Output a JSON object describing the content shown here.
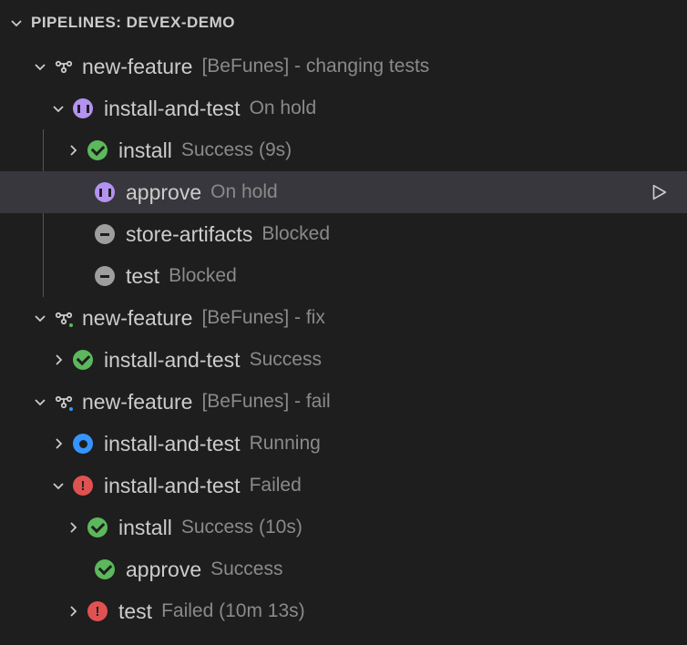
{
  "header": {
    "title": "PIPELINES: DEVEX-DEMO"
  },
  "pipelines": [
    {
      "name": "new-feature",
      "meta": "[BeFunes] - changing tests",
      "workflows": [
        {
          "name": "install-and-test",
          "status": "On hold",
          "status_type": "onhold",
          "jobs": [
            {
              "name": "install",
              "status": "Success (9s)",
              "status_type": "success",
              "has_chevron": true
            },
            {
              "name": "approve",
              "status": "On hold",
              "status_type": "onhold",
              "has_chevron": false,
              "highlight": true,
              "action": true
            },
            {
              "name": "store-artifacts",
              "status": "Blocked",
              "status_type": "blocked",
              "has_chevron": false
            },
            {
              "name": "test",
              "status": "Blocked",
              "status_type": "blocked",
              "has_chevron": false
            }
          ]
        }
      ]
    },
    {
      "name": "new-feature",
      "meta": "[BeFunes] - fix",
      "overlay": "success",
      "workflows": [
        {
          "name": "install-and-test",
          "status": "Success",
          "status_type": "success",
          "collapsed": true
        }
      ]
    },
    {
      "name": "new-feature",
      "meta": "[BeFunes] - fail",
      "overlay": "running",
      "workflows": [
        {
          "name": "install-and-test",
          "status": "Running",
          "status_type": "running",
          "collapsed": true
        },
        {
          "name": "install-and-test",
          "status": "Failed",
          "status_type": "failed",
          "jobs": [
            {
              "name": "install",
              "status": "Success (10s)",
              "status_type": "success",
              "has_chevron": true
            },
            {
              "name": "approve",
              "status": "Success",
              "status_type": "success",
              "has_chevron": false
            },
            {
              "name": "test",
              "status": "Failed (10m 13s)",
              "status_type": "failed",
              "has_chevron": true
            }
          ]
        }
      ]
    }
  ]
}
